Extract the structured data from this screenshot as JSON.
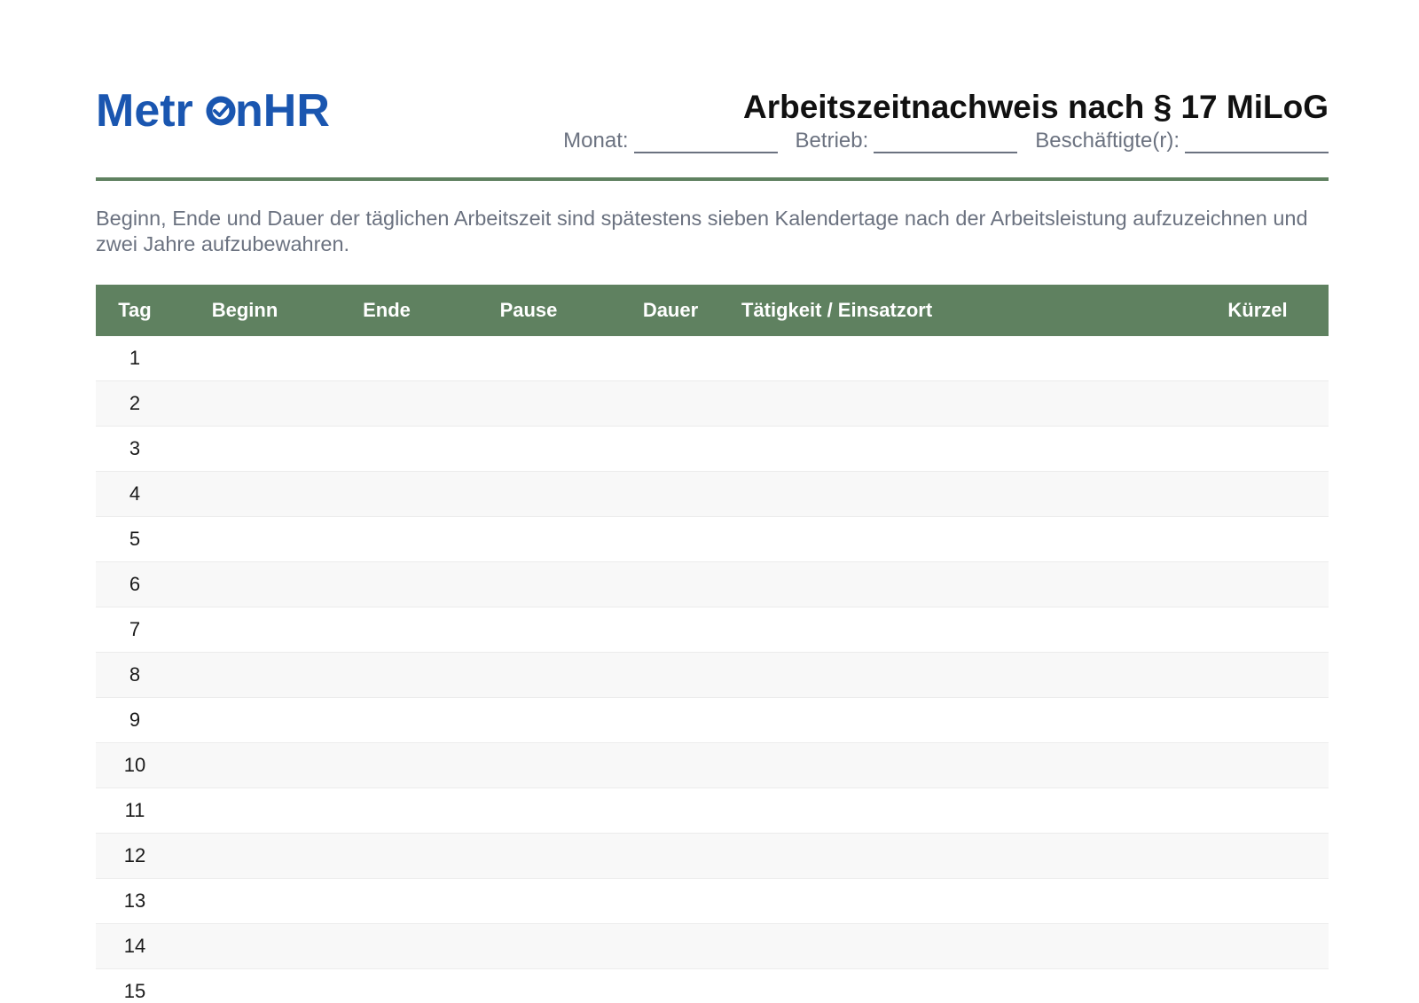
{
  "logo": {
    "text_prefix": "Metr",
    "text_suffix": "nHR",
    "full_name": "MetronHR",
    "color": "#1a56b0",
    "icon": "clock-check-o-icon"
  },
  "header": {
    "title": "Arbeitszeitnachweis nach § 17 MiLoG",
    "fields": [
      {
        "label": "Monat:"
      },
      {
        "label": "Betrieb:"
      },
      {
        "label": "Beschäftigte(r):"
      }
    ]
  },
  "intro": "Beginn, Ende und Dauer der täglichen Arbeitszeit sind spätestens sieben Kalendertage nach der Arbeitsleistung aufzuzeichnen und zwei Jahre aufzubewahren.",
  "table": {
    "columns": [
      "Tag",
      "Beginn",
      "Ende",
      "Pause",
      "Dauer",
      "Tätigkeit / Einsatzort",
      "Kürzel"
    ],
    "rows": [
      "1",
      "2",
      "3",
      "4",
      "5",
      "6",
      "7",
      "8",
      "9",
      "10",
      "11",
      "12",
      "13",
      "14",
      "15"
    ]
  },
  "colors": {
    "accent_green": "#5f8160",
    "brand_blue": "#1a56b0",
    "muted_text": "#6b7280"
  }
}
